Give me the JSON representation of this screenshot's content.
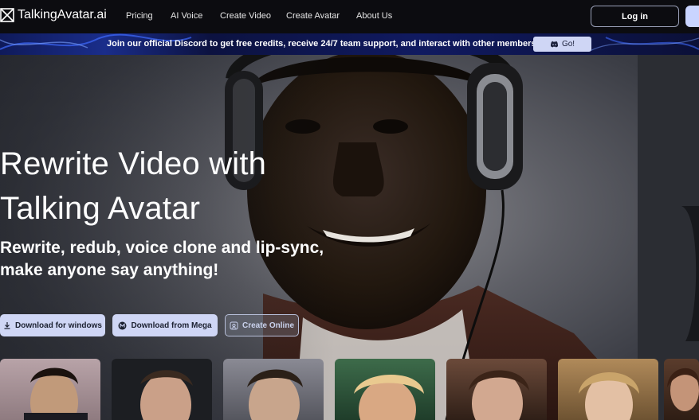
{
  "nav": {
    "brand": "TalkingAvatar.ai",
    "links": [
      {
        "label": "Pricing"
      },
      {
        "label": "AI Voice"
      },
      {
        "label": "Create Video"
      },
      {
        "label": "Create Avatar"
      },
      {
        "label": "About Us"
      }
    ],
    "login_label": "Log in"
  },
  "banner": {
    "text": "Join our official Discord to get free credits, receive 24/7 team support, and interact with other members!",
    "go_label": "Go!"
  },
  "hero": {
    "headline_line1": "Rewrite Video with",
    "headline_line2": "Talking Avatar",
    "subhead_line1": "Rewrite, redub, voice clone and lip-sync,",
    "subhead_line2": "make anyone say anything!",
    "buttons": {
      "download_windows": "Download for windows",
      "download_mega": "Download from Mega",
      "create_online": "Create Online"
    }
  },
  "colors": {
    "button_bg": "#cfd6f5",
    "nav_bg": "#0c0c10",
    "banner_bg": "#101a60"
  }
}
